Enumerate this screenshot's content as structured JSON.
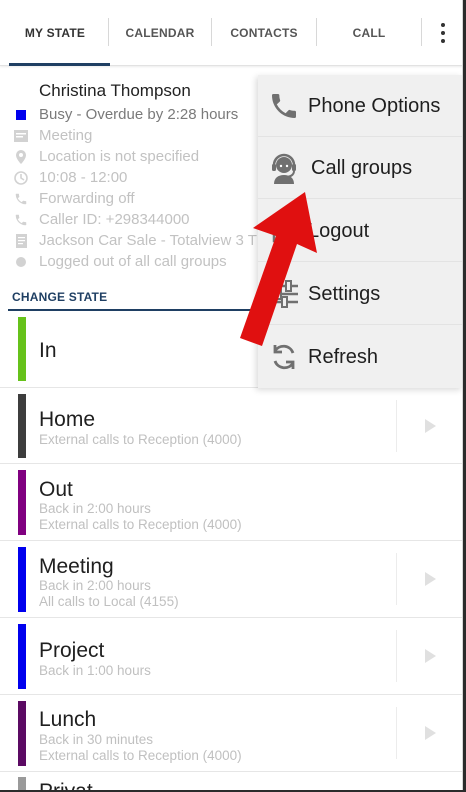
{
  "tabs": [
    {
      "label": "MY STATE",
      "active": true
    },
    {
      "label": "CALENDAR",
      "active": false
    },
    {
      "label": "CONTACTS",
      "active": false
    },
    {
      "label": "CALL",
      "active": false
    }
  ],
  "status": {
    "name": "Christina Thompson",
    "busy_text": "Busy - Overdue by 2:28 hours",
    "busy_color": "#0000ee",
    "details": [
      {
        "icon": "message-icon",
        "text": "Meeting"
      },
      {
        "icon": "location-pin-icon",
        "text": "Location is not specified"
      },
      {
        "icon": "clock-icon",
        "text": "10:08 - 12:00"
      },
      {
        "icon": "phone-forward-icon",
        "text": "Forwarding off"
      },
      {
        "icon": "phone-icon",
        "text": "Caller ID: +298344000"
      },
      {
        "icon": "document-icon",
        "text": "Jackson Car Sale - Totalview 3 T"
      },
      {
        "icon": "dot-icon",
        "text": "Logged out of all call groups"
      }
    ]
  },
  "change_state": {
    "title": "CHANGE STATE",
    "states": [
      {
        "name": "In",
        "color": "#66c21a",
        "lines": []
      },
      {
        "name": "Home",
        "color": "#3d3d3d",
        "lines": [
          "External calls to Reception (4000)"
        ]
      },
      {
        "name": "Out",
        "color": "#800080",
        "lines": [
          "Back in 2:00 hours",
          "External calls to Reception (4000)"
        ]
      },
      {
        "name": "Meeting",
        "color": "#0000ee",
        "lines": [
          "Back in 2:00 hours",
          "All calls to Local (4155)"
        ]
      },
      {
        "name": "Project",
        "color": "#0000ee",
        "lines": [
          "Back in 1:00 hours"
        ]
      },
      {
        "name": "Lunch",
        "color": "#5b0a63",
        "lines": [
          "Back in 30 minutes",
          "External calls to Reception (4000)"
        ]
      },
      {
        "name": "Privat",
        "color": "#9a9a9a",
        "lines": []
      }
    ]
  },
  "menu": {
    "items": [
      {
        "label": "Phone Options",
        "icon": "phone-icon"
      },
      {
        "label": "Call groups",
        "icon": "headset-agent-icon"
      },
      {
        "label": "Logout",
        "icon": "logout-icon"
      },
      {
        "label": "Settings",
        "icon": "sliders-icon"
      },
      {
        "label": "Refresh",
        "icon": "refresh-icon"
      }
    ]
  },
  "annotation_color": "#e01010"
}
